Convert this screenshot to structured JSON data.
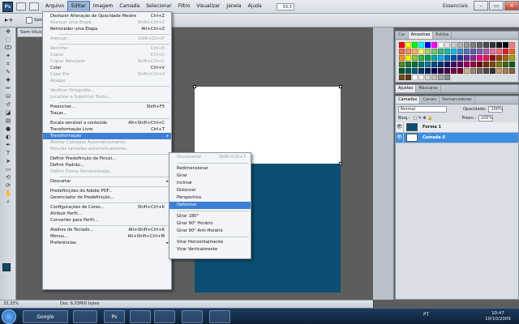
{
  "menubar": {
    "logo": "Ps",
    "items": [
      "Arquivo",
      "Editar",
      "Imagem",
      "Camada",
      "Selecionar",
      "Filtro",
      "Visualizar",
      "Janela",
      "Ajuda"
    ],
    "zoom": "33,3",
    "workspace": "Essenciais",
    "win_minimize": "–",
    "win_restore": "▭",
    "win_close": "×"
  },
  "options": {
    "tool_glyph": "▸+",
    "checkbox_label": "Sele"
  },
  "document": {
    "tab": "Sem título",
    "status_zoom": "33,33%",
    "status_doc": "Doc: 6,03M/0 bytes"
  },
  "edit_menu": {
    "items": [
      {
        "label": "Desfazer Alteração de Opacidade Mestre",
        "shortcut": "Ctrl+Z",
        "disabled": false
      },
      {
        "label": "Avançar uma Etapa",
        "shortcut": "Shift+Ctrl+Z",
        "disabled": true
      },
      {
        "label": "Retroceder uma Etapa",
        "shortcut": "Alt+Ctrl+Z",
        "disabled": false
      },
      {
        "sep": true
      },
      {
        "label": "Atenuar...",
        "shortcut": "Shift+Ctrl+F",
        "disabled": true
      },
      {
        "sep": true
      },
      {
        "label": "Recortar",
        "shortcut": "Ctrl+X",
        "disabled": true
      },
      {
        "label": "Copiar",
        "shortcut": "Ctrl+C",
        "disabled": true
      },
      {
        "label": "Copiar Mesclado",
        "shortcut": "Shift+Ctrl+C",
        "disabled": true
      },
      {
        "label": "Colar",
        "shortcut": "Ctrl+V",
        "disabled": false
      },
      {
        "label": "Colar Em",
        "shortcut": "Shift+Ctrl+V",
        "disabled": true
      },
      {
        "label": "Apagar",
        "shortcut": "",
        "disabled": true
      },
      {
        "sep": true
      },
      {
        "label": "Verificar Ortografia...",
        "shortcut": "",
        "disabled": true
      },
      {
        "label": "Localizar e Substituir Texto...",
        "shortcut": "",
        "disabled": true
      },
      {
        "sep": true
      },
      {
        "label": "Preencher...",
        "shortcut": "Shift+F5",
        "disabled": false
      },
      {
        "label": "Traçar...",
        "shortcut": "",
        "disabled": false
      },
      {
        "sep": true
      },
      {
        "label": "Escala sensível a conteúdo",
        "shortcut": "Alt+Shift+Ctrl+C",
        "disabled": false
      },
      {
        "label": "Transformação Livre",
        "shortcut": "Ctrl+T",
        "disabled": false
      },
      {
        "label": "Transformação",
        "shortcut": "",
        "disabled": false,
        "submenu": true,
        "highlight": true
      },
      {
        "label": "Alinhar Camadas Automaticamente...",
        "shortcut": "",
        "disabled": true
      },
      {
        "label": "Mesclar camadas automaticamente...",
        "shortcut": "",
        "disabled": true
      },
      {
        "sep": true
      },
      {
        "label": "Definir Predefinição de Pincel...",
        "shortcut": "",
        "disabled": false
      },
      {
        "label": "Definir Padrão...",
        "shortcut": "",
        "disabled": false
      },
      {
        "label": "Definir Forma Personalizada...",
        "shortcut": "",
        "disabled": true
      },
      {
        "sep": true
      },
      {
        "label": "Descartar",
        "shortcut": "",
        "disabled": false,
        "submenu": true
      },
      {
        "sep": true
      },
      {
        "label": "Predefinições do Adobe PDF...",
        "shortcut": "",
        "disabled": false
      },
      {
        "label": "Gerenciador de Predefinição...",
        "shortcut": "",
        "disabled": false
      },
      {
        "sep": true
      },
      {
        "label": "Configurações de Cores...",
        "shortcut": "Shift+Ctrl+K",
        "disabled": false
      },
      {
        "label": "Atribuir Perfil...",
        "shortcut": "",
        "disabled": false
      },
      {
        "label": "Converter para Perfil...",
        "shortcut": "",
        "disabled": false
      },
      {
        "sep": true
      },
      {
        "label": "Atalhos de Teclado...",
        "shortcut": "Alt+Shift+Ctrl+K",
        "disabled": false
      },
      {
        "label": "Menus...",
        "shortcut": "Alt+Shift+Ctrl+M",
        "disabled": false
      },
      {
        "label": "Preferências",
        "shortcut": "",
        "disabled": false,
        "submenu": true
      }
    ]
  },
  "transform_submenu": {
    "items": [
      {
        "label": "Novamente",
        "shortcut": "Shift+Ctrl+T",
        "disabled": true
      },
      {
        "sep": true
      },
      {
        "label": "Redimensionar",
        "disabled": false
      },
      {
        "label": "Girar",
        "disabled": false
      },
      {
        "label": "Inclinar",
        "disabled": false
      },
      {
        "label": "Distorcer",
        "disabled": false
      },
      {
        "label": "Perspectiva",
        "disabled": false
      },
      {
        "label": "Deformar",
        "disabled": false,
        "highlight": true
      },
      {
        "sep": true
      },
      {
        "label": "Girar 180°",
        "disabled": false
      },
      {
        "label": "Girar 90° Horário",
        "disabled": false
      },
      {
        "label": "Girar 90° Anti-Horário",
        "disabled": false
      },
      {
        "sep": true
      },
      {
        "label": "Virar Horizontalmente",
        "disabled": false
      },
      {
        "label": "Virar Verticalmente",
        "disabled": false
      }
    ]
  },
  "swatches_panel": {
    "tabs": [
      "Cor",
      "Amostras",
      "Estilos"
    ],
    "colors": [
      "#ff0000",
      "#ffff00",
      "#00ff00",
      "#00ffff",
      "#0000ff",
      "#ff00ff",
      "#ffffff",
      "#e6e6e6",
      "#cccccc",
      "#b3b3b3",
      "#999999",
      "#808080",
      "#666666",
      "#4d4d4d",
      "#333333",
      "#1a1a1a",
      "#000000",
      "#ff8080",
      "#f26c4f",
      "#f68e55",
      "#fbaf5c",
      "#fff467",
      "#acd372",
      "#7cc576",
      "#3bb878",
      "#1abbb4",
      "#00bff3",
      "#438ccb",
      "#5574b9",
      "#605ca8",
      "#855fa8",
      "#a763a8",
      "#f06ea9",
      "#f26d7d",
      "#ed1c24",
      "#f26522",
      "#f7941d",
      "#fff200",
      "#8dc63f",
      "#39b54a",
      "#00a651",
      "#00a99d",
      "#00aeef",
      "#0072bc",
      "#0054a6",
      "#2e3192",
      "#662d91",
      "#92278f",
      "#ec008c",
      "#ed145b",
      "#9e0b0f",
      "#a0410d",
      "#a3620a",
      "#aba000",
      "#598527",
      "#1a7b30",
      "#007236",
      "#00746b",
      "#0076a3",
      "#004a80",
      "#003471",
      "#1b1464",
      "#440e62",
      "#630460",
      "#9e005d",
      "#9e0039",
      "#790000",
      "#7b2e00",
      "#7d4900",
      "#827b00",
      "#406618",
      "#005e20",
      "#005826",
      "#005952",
      "#005b7f",
      "#003663",
      "#002157",
      "#0d004c",
      "#32004b",
      "#4b0049",
      "#7b0046",
      "#7a0026",
      "#c7b299",
      "#998675",
      "#736357",
      "#534741",
      "#37302d",
      "#c69c6d",
      "#a67c52",
      "#8c6239",
      "#754c24",
      "#603913",
      "#ffffff",
      "#f2f2f2",
      "#d9d9d9",
      "#bfbfbf",
      "#a6a6a6",
      "#8c8c8c"
    ]
  },
  "adjust_panel": {
    "tabs": [
      "Ajustes",
      "Máscaras"
    ]
  },
  "layers_panel": {
    "tabs": [
      "Camadas",
      "Canais",
      "Demarcadores"
    ],
    "blend": "Normal",
    "opacity_label": "Opacidade:",
    "opacity": "100%",
    "lock_label": "Bloq.:",
    "fill_label": "Preen.:",
    "fill": "100%",
    "layers": [
      {
        "name": "Forma 1",
        "thumb": "#0b4f72",
        "selected": false
      },
      {
        "name": "Camada 0",
        "thumb": "#ffffff",
        "selected": true
      }
    ]
  },
  "taskbar": {
    "apps": [
      {
        "label": "Google"
      },
      {
        "label": ""
      },
      {
        "label": "Ps"
      },
      {
        "label": ""
      },
      {
        "label": ""
      },
      {
        "label": ""
      },
      {
        "label": ""
      }
    ],
    "lang": "PT",
    "time": "10:47",
    "date": "10/10/2009"
  }
}
